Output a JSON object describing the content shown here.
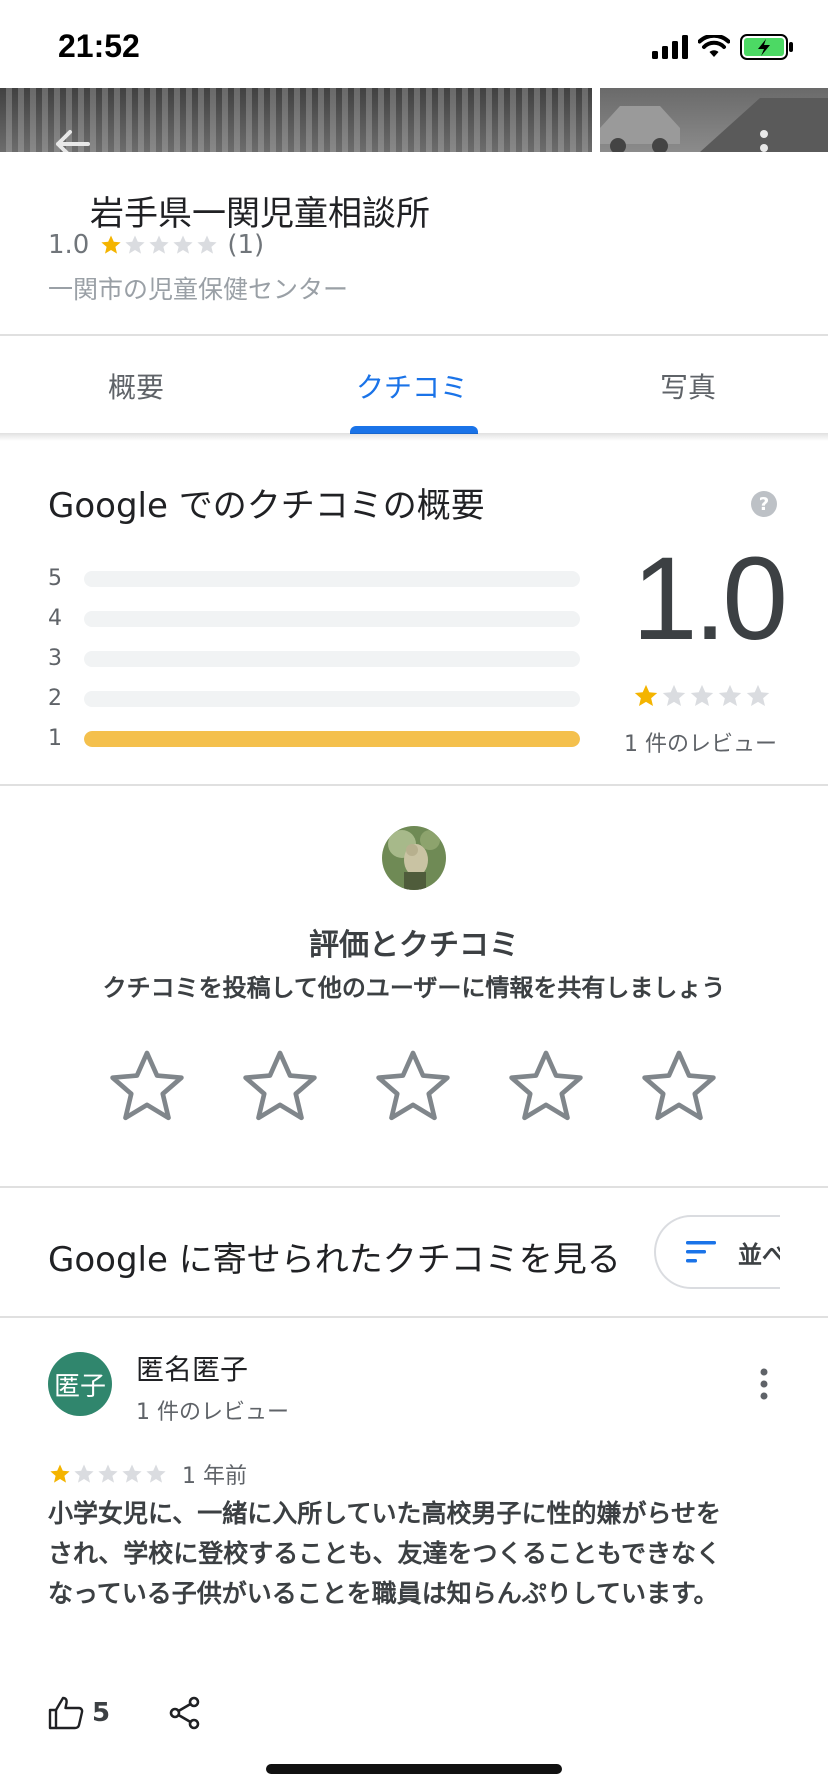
{
  "status_bar": {
    "time": "21:52"
  },
  "place": {
    "title": "岩手県一関児童相談所",
    "rating": "1.0",
    "stars_filled": 1,
    "review_count_paren": "(1)",
    "category": "一関市の児童保健センター"
  },
  "tabs": [
    {
      "label": "概要",
      "active": false
    },
    {
      "label": "クチコミ",
      "active": true
    },
    {
      "label": "写真",
      "active": false
    }
  ],
  "summary": {
    "title": "Google でのクチコミの概要",
    "distribution": [
      {
        "label": "5",
        "fraction": 0
      },
      {
        "label": "4",
        "fraction": 0
      },
      {
        "label": "3",
        "fraction": 0
      },
      {
        "label": "2",
        "fraction": 0
      },
      {
        "label": "1",
        "fraction": 1
      }
    ],
    "average": "1.0",
    "stars_filled": 1,
    "review_count": "1 件のレビュー"
  },
  "rate_prompt": {
    "title": "評価とクチコミ",
    "subtitle": "クチコミを投稿して他のユーザーに情報を共有しましょう"
  },
  "reviews_section": {
    "title": "Google に寄せられたクチコミを見る",
    "sort_label": "並べ"
  },
  "review": {
    "avatar_text": "匿子",
    "author": "匿名匿子",
    "author_meta": "1 件のレビュー",
    "stars_filled": 1,
    "date": "1 年前",
    "text": "小学女児に、一緒に入所していた高校男子に性的嫌がらせをされ、学校に登校することも、友達をつくることもできなくなっている子供がいることを職員は知らんぷりしています。",
    "like_count": "5"
  },
  "colors": {
    "accent": "#1a73e8",
    "star": "#f4b400",
    "star_empty": "#dadce0",
    "bar_fill": "#f4c04d",
    "avatar": "#30866d"
  }
}
